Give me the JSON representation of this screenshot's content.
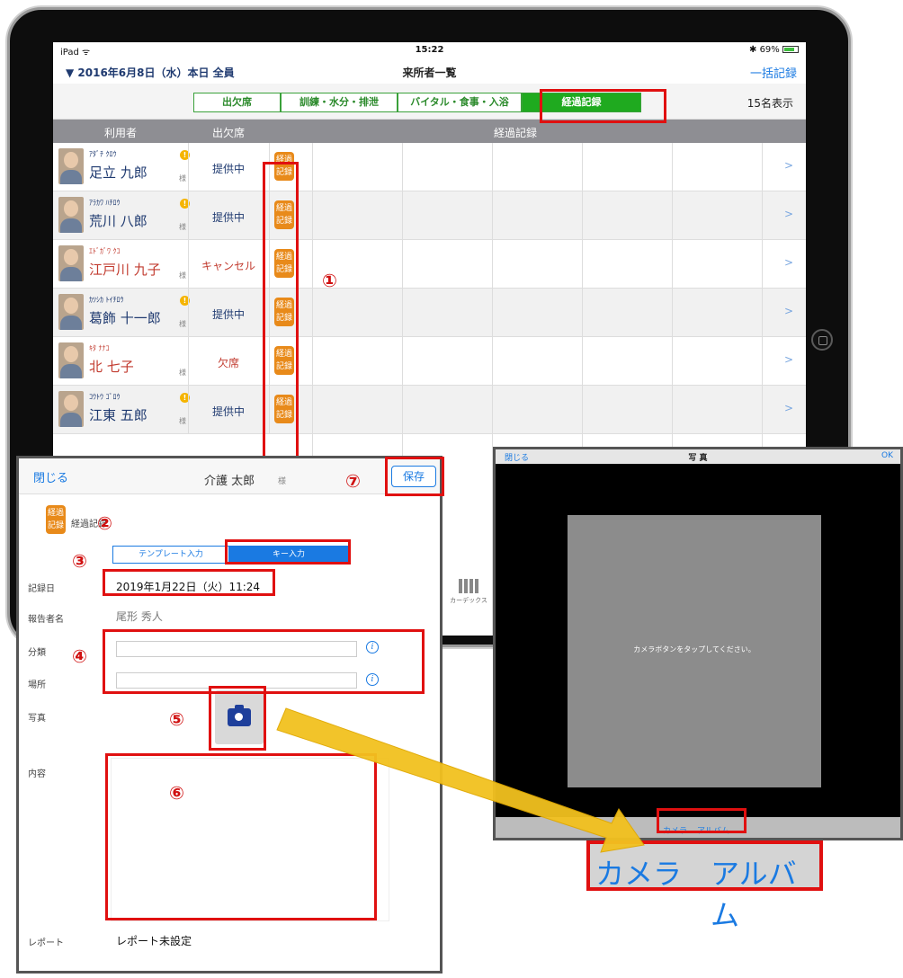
{
  "status_bar": {
    "device": "iPad ᯤ",
    "time": "15:22",
    "battery": "✱ 69%"
  },
  "nav": {
    "date": "▼ 2016年6月8日（水）本日 全員",
    "title": "来所者一覧",
    "bulk": "一括記録"
  },
  "segments": [
    {
      "label": "出欠席"
    },
    {
      "label": "訓練・水分・排泄"
    },
    {
      "label": "バイタル・食事・入浴"
    },
    {
      "label": "経過記録"
    }
  ],
  "count": "15名表示",
  "table_header": {
    "user": "利用者",
    "attendance": "出欠席",
    "progress": "経過記録"
  },
  "rows": [
    {
      "kana": "ｱﾀﾞﾁ ｸﾛｳ",
      "name": "足立 九郎",
      "sama": "様",
      "status": "提供中",
      "tag": "経過記録",
      "chev": ">"
    },
    {
      "kana": "ｱﾗｶﾜ ﾊﾁﾛｳ",
      "name": "荒川 八郎",
      "sama": "様",
      "status": "提供中",
      "tag": "経過記録",
      "chev": ">"
    },
    {
      "kana": "ｴﾄﾞｶﾞﾜ ｸｺ",
      "name": "江戸川 九子",
      "sama": "様",
      "status": "キャンセル",
      "tag": "経過記録",
      "chev": ">"
    },
    {
      "kana": "ｶﾂｼｶ ﾄｲﾁﾛｳ",
      "name": "葛飾 十一郎",
      "sama": "様",
      "status": "提供中",
      "tag": "経過記録",
      "chev": ">"
    },
    {
      "kana": "ｷﾀ ﾅﾅｺ",
      "name": "北 七子",
      "sama": "様",
      "status": "欠席",
      "tag": "経過記録",
      "chev": ">"
    },
    {
      "kana": "ｺｳﾄｳ ｺﾞﾛｳ",
      "name": "江東 五郎",
      "sama": "様",
      "status": "提供中",
      "tag": "経過記録",
      "chev": ">"
    }
  ],
  "annotations": {
    "n1": "①",
    "n2": "②",
    "n3": "③",
    "n4": "④",
    "n5": "⑤",
    "n6": "⑥",
    "n7": "⑦"
  },
  "record_panel": {
    "close": "閉じる",
    "name": "介護 太郎",
    "sama": "様",
    "save": "保存",
    "tag": "経過記録",
    "section_title": "経過記録",
    "seg_template": "テンプレート入力",
    "seg_key": "キー入力",
    "date_label": "記録日",
    "date_value": "2019年1月22日（火）11:24",
    "reporter_label": "報告者名",
    "reporter_value": "尾形 秀人",
    "category_label": "分類",
    "place_label": "場所",
    "photo_label": "写真",
    "content_label": "内容",
    "report_label": "レポート",
    "report_value": "レポート未設定",
    "info_icon": "i"
  },
  "kardex_label": "カーデックス",
  "photo_panel": {
    "close": "閉じる",
    "title": "写 真",
    "ok": "OK",
    "message": "カメラボタンをタップしてください。",
    "camera": "カメラ",
    "album": "アルバム"
  },
  "callout": {
    "camera": "カメラ",
    "album": "アルバム"
  },
  "colors": {
    "accent_green": "#1faa1f",
    "accent_blue": "#1a7ae2",
    "highlight_red": "#e01010",
    "arrow_yellow": "#f2c11f"
  }
}
